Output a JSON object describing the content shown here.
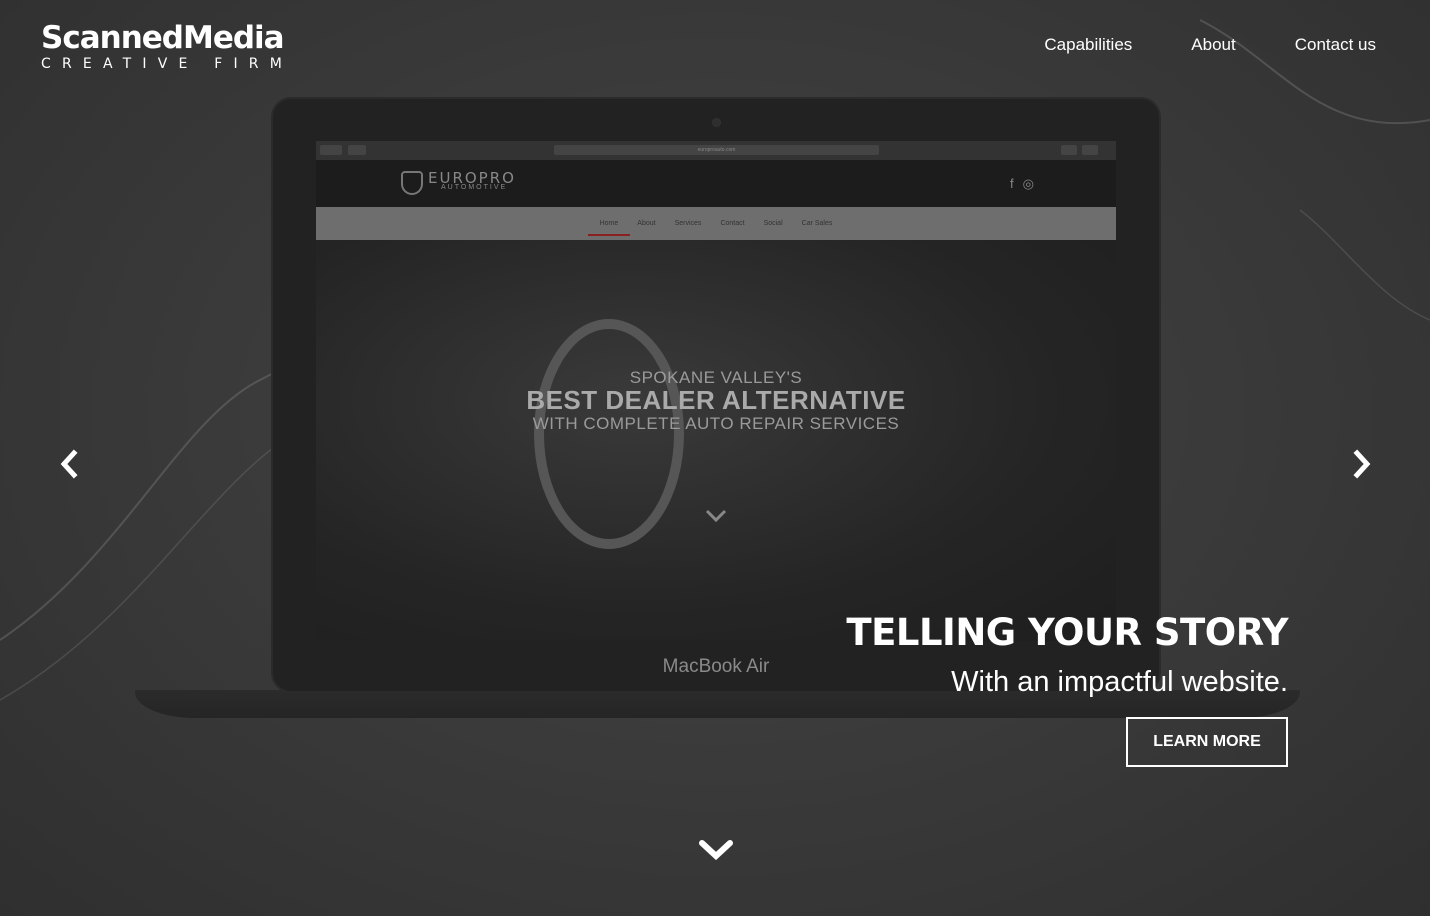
{
  "brand": {
    "name": "ScannedMedia",
    "tagline": "CREATIVE FIRM"
  },
  "nav": {
    "items": [
      {
        "label": "Capabilities"
      },
      {
        "label": "About"
      },
      {
        "label": "Contact us"
      }
    ]
  },
  "slide": {
    "device_label": "MacBook Air",
    "screen": {
      "site_logo_name": "EUROPRO",
      "site_logo_tag": "AUTOMOTIVE",
      "site_nav": [
        "Home",
        "About",
        "Services",
        "Contact",
        "Social",
        "Car Sales"
      ],
      "hero_line1": "SPOKANE VALLEY'S",
      "hero_line2": "BEST DEALER ALTERNATIVE",
      "hero_line3": "WITH COMPLETE AUTO REPAIR SERVICES",
      "url": "europroauto.com"
    },
    "caption_title": "TELLING YOUR STORY",
    "caption_subtitle": "With an impactful website.",
    "cta_label": "LEARN MORE"
  },
  "icons": {
    "prev": "chevron-left-icon",
    "next": "chevron-right-icon",
    "scroll": "chevron-down-icon",
    "facebook": "facebook-icon",
    "instagram": "instagram-icon"
  },
  "colors": {
    "background": "#3a3a3a",
    "text": "#ffffff",
    "site_accent": "#8a2020"
  }
}
